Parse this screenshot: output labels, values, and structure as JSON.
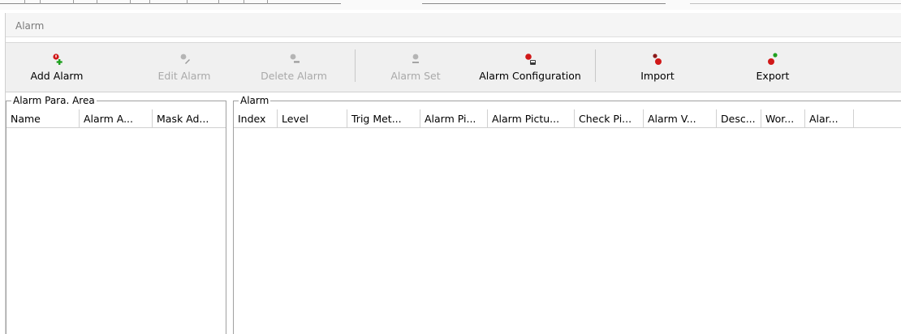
{
  "window": {
    "title": "Alarm"
  },
  "toolbar": {
    "buttons": [
      {
        "label": "Add Alarm",
        "icon": "add-alarm-icon",
        "enabled": true
      },
      {
        "label": "Edit Alarm",
        "icon": "edit-alarm-icon",
        "enabled": false
      },
      {
        "label": "Delete Alarm",
        "icon": "delete-alarm-icon",
        "enabled": false
      },
      {
        "label": "Alarm Set",
        "icon": "alarm-set-icon",
        "enabled": false
      },
      {
        "label": "Alarm Configuration",
        "icon": "alarm-configuration-icon",
        "enabled": true
      },
      {
        "label": "Import",
        "icon": "import-icon",
        "enabled": true
      },
      {
        "label": "Export",
        "icon": "export-icon",
        "enabled": true
      }
    ]
  },
  "left_panel": {
    "title": "Alarm Para. Area",
    "columns": [
      "Name",
      "Alarm A...",
      "Mask Ad..."
    ]
  },
  "right_panel": {
    "title": "Alarm",
    "columns": [
      "Index",
      "Level",
      "Trig Met...",
      "Alarm Pi...",
      "Alarm Pictu...",
      "Check Pi...",
      "Alarm V...",
      "Desc...",
      "Wor...",
      "Alar..."
    ]
  },
  "colors": {
    "alarm_red": "#d01818",
    "add_green": "#1fa01f",
    "disabled_gray": "#b4b4b4"
  }
}
